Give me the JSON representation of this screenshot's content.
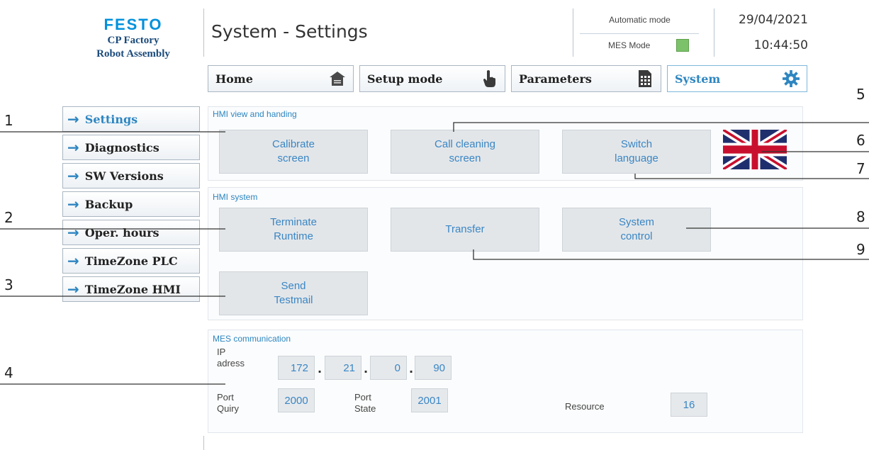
{
  "logo": {
    "brand": "FESTO",
    "line1": "CP Factory",
    "line2": "Robot Assembly"
  },
  "header": {
    "title": "System - Settings",
    "mode": "Automatic mode",
    "mes_mode": "MES Mode",
    "date": "29/04/2021",
    "time": "10:44:50"
  },
  "topnav": [
    {
      "label": "Home",
      "icon": "house-icon"
    },
    {
      "label": "Setup mode",
      "icon": "hand-pointer-icon"
    },
    {
      "label": "Parameters",
      "icon": "document-table-icon"
    },
    {
      "label": "System",
      "icon": "gear-icon"
    }
  ],
  "sidebar": [
    {
      "label": "Settings"
    },
    {
      "label": "Diagnostics"
    },
    {
      "label": "SW Versions"
    },
    {
      "label": "Backup"
    },
    {
      "label": "Oper. hours"
    },
    {
      "label": "TimeZone PLC"
    },
    {
      "label": "TimeZone HMI"
    }
  ],
  "hmi_view": {
    "title": "HMI view and handing",
    "calibrate": "Calibrate\nscreen",
    "cleaning": "Call cleaning\nscreen",
    "language": "Switch\nlanguage"
  },
  "hmi_system": {
    "title": "HMI system",
    "terminate": "Terminate\nRuntime",
    "transfer": "Transfer",
    "system_control": "System\ncontrol",
    "testmail": "Send\nTestmail"
  },
  "mes": {
    "title": "MES communication",
    "ip_label": "IP\nadress",
    "ip": [
      "172",
      "21",
      "0",
      "90"
    ],
    "port_query_label": "Port\nQuiry",
    "port_query": "2000",
    "port_state_label": "Port\nState",
    "port_state": "2001",
    "resource_label": "Resource",
    "resource": "16"
  },
  "callouts": [
    "1",
    "2",
    "3",
    "4",
    "5",
    "6",
    "7",
    "8",
    "9"
  ],
  "colors": {
    "accent": "#2e86c1",
    "brand": "#0091dc",
    "mes_indicator": "#7cc26a"
  }
}
